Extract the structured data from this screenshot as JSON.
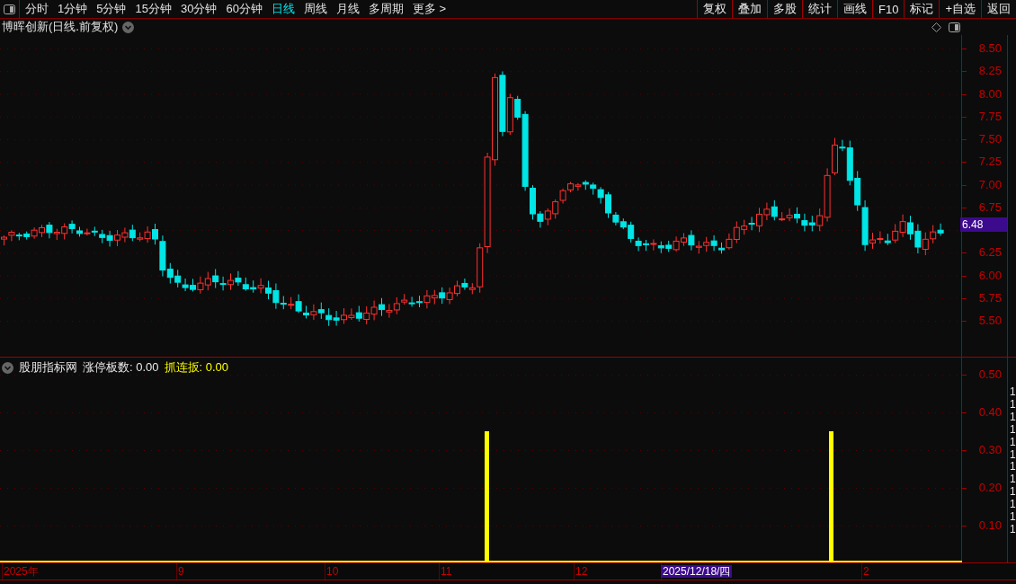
{
  "toolbar": {
    "periods": [
      {
        "label": "分时",
        "selected": false
      },
      {
        "label": "1分钟",
        "selected": false
      },
      {
        "label": "5分钟",
        "selected": false
      },
      {
        "label": "15分钟",
        "selected": false
      },
      {
        "label": "30分钟",
        "selected": false
      },
      {
        "label": "60分钟",
        "selected": false
      },
      {
        "label": "日线",
        "selected": true
      },
      {
        "label": "周线",
        "selected": false
      },
      {
        "label": "月线",
        "selected": false
      },
      {
        "label": "多周期",
        "selected": false
      },
      {
        "label": "更多 >",
        "selected": false
      }
    ],
    "actions": [
      "复权",
      "叠加",
      "多股",
      "统计",
      "画线",
      "F10",
      "标记",
      "+自选",
      "返回"
    ]
  },
  "price_chart": {
    "title": "博晖创新(日线.前复权)",
    "ticks": [
      "8.50",
      "8.25",
      "8.00",
      "7.75",
      "7.50",
      "7.25",
      "7.00",
      "6.75",
      "6.25",
      "6.00",
      "5.75",
      "5.50"
    ],
    "last_price": "6.48"
  },
  "indicator": {
    "name": "股朋指标网",
    "values": [
      {
        "label": "涨停板数: 0.00",
        "color": "#e8e8e8"
      },
      {
        "label": "抓连扳: 0.00",
        "color": "#ffff00"
      }
    ],
    "ticks": [
      "0.50",
      "0.40",
      "0.30",
      "0.20",
      "0.10"
    ],
    "side_values": [
      "1",
      "1",
      "1",
      "1",
      "1",
      "1",
      "1",
      "1",
      "1",
      "1",
      "1",
      "1"
    ]
  },
  "date_axis": [
    {
      "label": "2025年",
      "selected": false
    },
    {
      "label": "9",
      "selected": false
    },
    {
      "label": "10",
      "selected": false
    },
    {
      "label": "11",
      "selected": false
    },
    {
      "label": "12",
      "selected": false
    },
    {
      "label": "2025/12/18/四",
      "selected": true
    },
    {
      "label": "2",
      "selected": false
    }
  ]
}
